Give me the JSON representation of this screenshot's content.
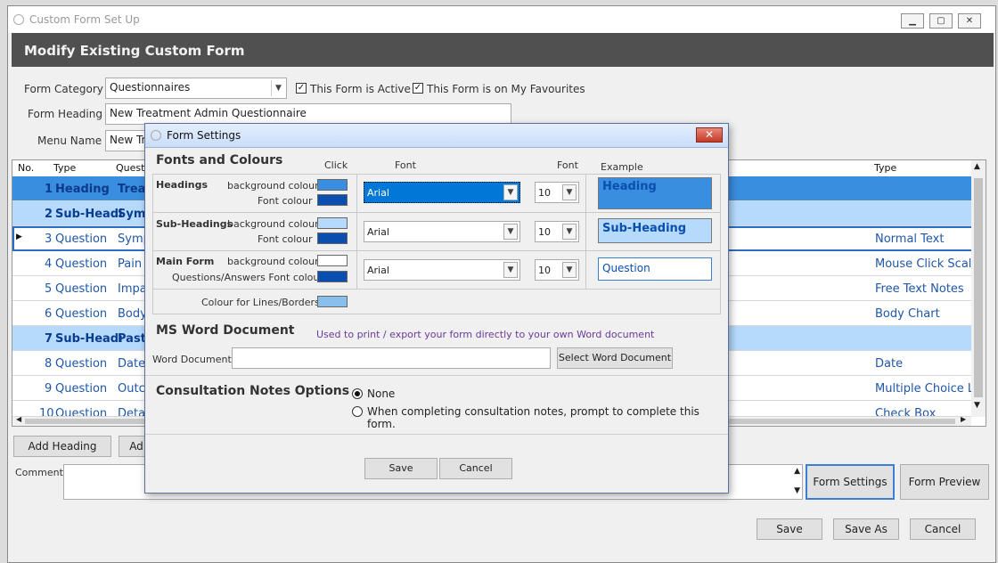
{
  "window": {
    "title": "Custom Form Set Up",
    "min_glyph": "▁",
    "max_glyph": "▢",
    "close_glyph": "✕"
  },
  "header": {
    "title": "Modify Existing Custom Form"
  },
  "form": {
    "category_label": "Form Category",
    "category_value": "Questionnaires",
    "active_label": "This Form is Active",
    "favourites_label": "This Form is on My Favourites",
    "heading_label": "Form Heading",
    "heading_value": "New Treatment Admin Questionnaire",
    "menu_label": "Menu Name",
    "menu_value": "New Tr",
    "check_glyph": "✓"
  },
  "grid": {
    "col_no": "No.",
    "col_type": "Type",
    "col_question": "Questio",
    "col_type2": "Type",
    "row_marker": "▶",
    "rows": [
      {
        "no": "1",
        "type": "Heading",
        "text": "Treat",
        "type2": ""
      },
      {
        "no": "2",
        "type": "Sub-Headi",
        "text": "Symp",
        "type2": ""
      },
      {
        "no": "3",
        "type": "Question",
        "text": "Symp",
        "type2": "Normal Text"
      },
      {
        "no": "4",
        "type": "Question",
        "text": "Pain",
        "type2": "Mouse Click Scale"
      },
      {
        "no": "5",
        "type": "Question",
        "text": "Impac",
        "type2": "Free Text Notes"
      },
      {
        "no": "6",
        "type": "Question",
        "text": "Body",
        "type2": "Body Chart"
      },
      {
        "no": "7",
        "type": "Sub-Headi",
        "text": "Past",
        "type2": ""
      },
      {
        "no": "8",
        "type": "Question",
        "text": "Date",
        "type2": "Date"
      },
      {
        "no": "9",
        "type": "Question",
        "text": "Outco",
        "type2": "Multiple Choice Lis"
      },
      {
        "no": "10",
        "type": "Question",
        "text": "Detai",
        "type2": "Check Box"
      }
    ]
  },
  "buttons": {
    "add_heading": "Add Heading",
    "add_other": "Ad",
    "comments_label": "Comments",
    "form_settings": "Form Settings",
    "form_preview": "Form Preview",
    "save": "Save",
    "save_as": "Save As",
    "cancel": "Cancel"
  },
  "dialog": {
    "title": "Form Settings",
    "close_glyph": "✕",
    "fonts_title": "Fonts and Colours",
    "col_click": "Click",
    "col_font": "Font",
    "col_font_size": "Font",
    "col_example": "Example",
    "headings_label": "Headings",
    "sub_headings_label": "Sub-Headings",
    "main_form_label": "Main Form",
    "bg_colour_label": "background colour",
    "font_colour_label": "Font colour",
    "qa_font_colour_label": "Questions/Answers Font colour",
    "lines_label": "Colour for Lines/Borders",
    "heading_font": "Arial",
    "heading_size": "10",
    "sub_font": "Arial",
    "sub_size": "10",
    "main_font": "Arial",
    "main_size": "10",
    "example_heading": "Heading",
    "example_sub": "Sub-Heading",
    "example_question": "Question",
    "word_title": "MS Word Document",
    "word_note": "Used to print / export your form directly to your own Word document",
    "word_label": "Word Document",
    "word_value": "",
    "select_word": "Select Word Document",
    "consult_title": "Consultation Notes Options",
    "opt_none": "None",
    "opt_prompt": "When completing consultation notes, prompt to complete this form.",
    "save": "Save",
    "cancel": "Cancel",
    "colors": {
      "heading_bg": "#3a8ee0",
      "heading_font": "#0a4fb0",
      "sub_bg": "#b5dafc",
      "sub_font": "#0a4fb0",
      "main_bg": "#ffffff",
      "main_font": "#0a4fb0",
      "lines": "#88c0ec"
    }
  }
}
